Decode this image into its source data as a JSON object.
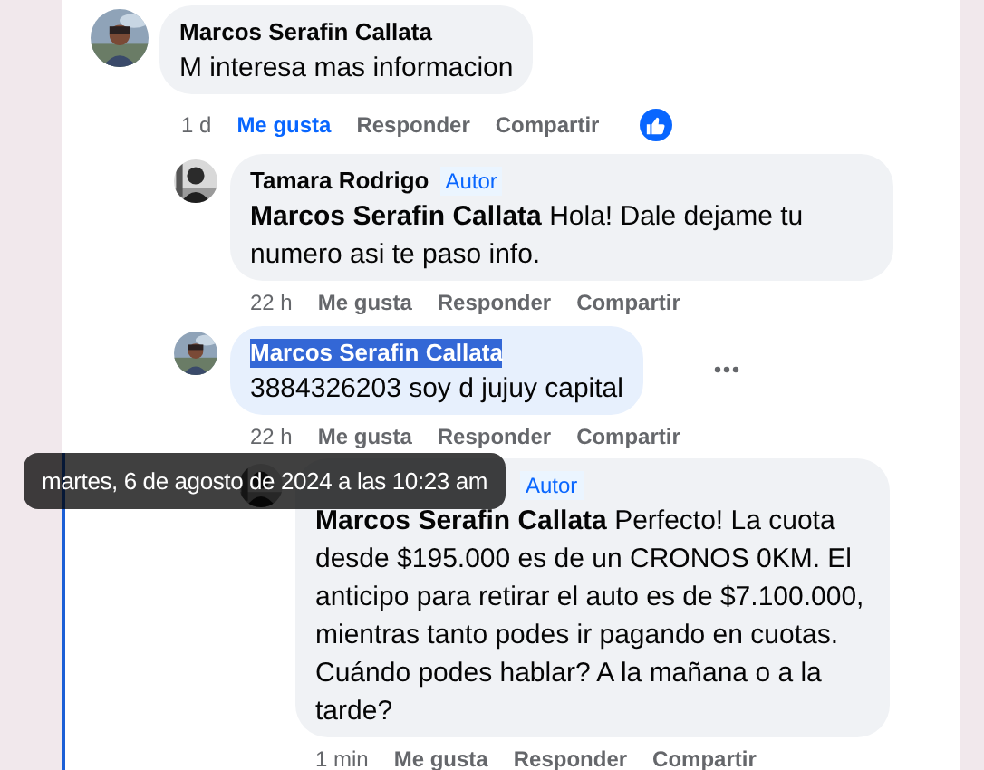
{
  "comment": {
    "author": "Marcos Serafin Callata",
    "text": "M interesa mas informacion",
    "time": "1 d",
    "liked": true,
    "reaction": true,
    "name_selected": false,
    "actions": [
      "Me gusta",
      "Responder",
      "Compartir"
    ],
    "replies": [
      {
        "author": "Tamara Rodrigo",
        "badge": "Autor",
        "text": "**Marcos Serafin Callata** Hola! Dale dejame tu numero asi te paso info.",
        "time": "22 h",
        "liked": false,
        "name_selected": false,
        "more_menu": false,
        "focused": false,
        "actions": [
          "Me gusta",
          "Responder",
          "Compartir"
        ]
      },
      {
        "author": "Marcos Serafin Callata",
        "text": "3884326203 soy d jujuy capital",
        "time": "22 h",
        "liked": false,
        "name_selected": true,
        "more_menu": true,
        "focused": false,
        "actions": [
          "Me gusta",
          "Responder",
          "Compartir"
        ]
      },
      {
        "badge": "Autor",
        "text": "**Marcos Serafin Callata** Perfecto! La cuota desde $195.000 es de un CRONOS 0KM. El anticipo para retirar el auto es de $7.100.000, mientras tanto podes ir pagando en cuotas. Cuándo podes hablar? A la mañana o a la tarde?",
        "time": "1 min",
        "liked": false,
        "more_menu": false,
        "focused": true,
        "actions": [
          "Me gusta",
          "Responder",
          "Compartir"
        ]
      }
    ]
  },
  "tooltip": {
    "text": "martes, 6 de agosto de 2024 a las 10:23 am"
  }
}
